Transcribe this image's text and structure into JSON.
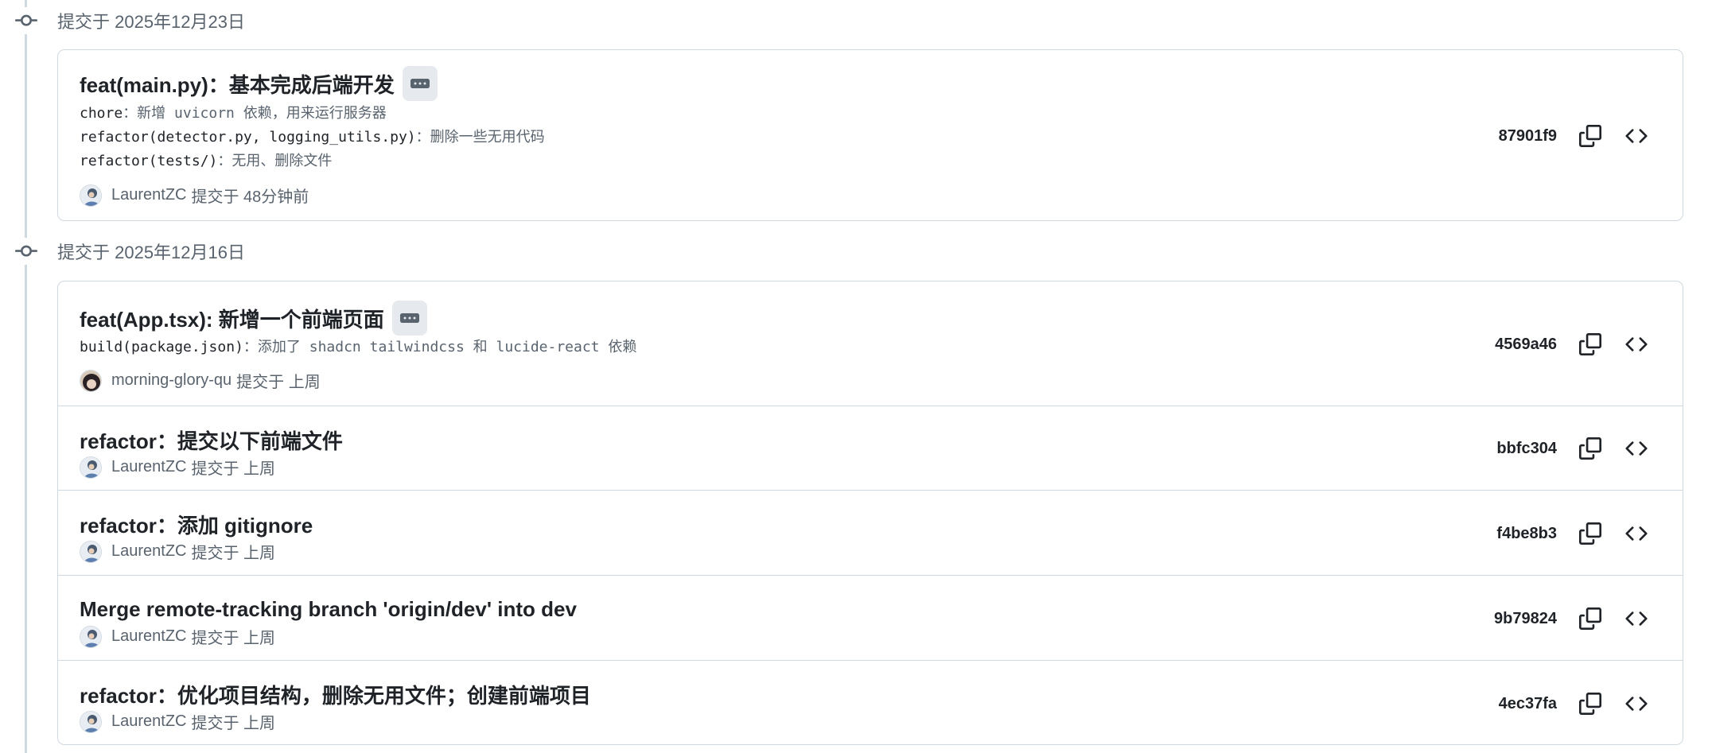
{
  "groups": [
    {
      "header": "提交于 2025年12月23日",
      "commits": [
        {
          "title": "feat(main.py)：基本完成后端开发",
          "has_body": true,
          "body": [
            {
              "prefix": "chore",
              "rest": "：新增 uvicorn 依赖，用来运行服务器"
            },
            {
              "prefix": "refactor(detector.py, logging_utils.py)",
              "rest": "：删除一些无用代码"
            },
            {
              "prefix": "refactor(tests/)",
              "rest": "：无用、删除文件"
            }
          ],
          "author": "LaurentZC",
          "verb": "提交于 48分钟前",
          "sha": "87901f9",
          "avatar": "laurent"
        }
      ]
    },
    {
      "header": "提交于 2025年12月16日",
      "commits": [
        {
          "title": "feat(App.tsx): 新增一个前端页面",
          "has_body": true,
          "body": [
            {
              "prefix": "build(package.json)",
              "rest": "：添加了 shadcn tailwindcss 和 lucide-react 依赖"
            }
          ],
          "author": "morning-glory-qu",
          "verb": "提交于 上周",
          "sha": "4569a46",
          "avatar": "morning"
        },
        {
          "title": "refactor：提交以下前端文件",
          "has_body": false,
          "body": [],
          "author": "LaurentZC",
          "verb": "提交于 上周",
          "sha": "bbfc304",
          "avatar": "laurent"
        },
        {
          "title": "refactor：添加 gitignore",
          "has_body": false,
          "body": [],
          "author": "LaurentZC",
          "verb": "提交于 上周",
          "sha": "f4be8b3",
          "avatar": "laurent"
        },
        {
          "title": "Merge remote-tracking branch 'origin/dev' into dev",
          "has_body": false,
          "body": [],
          "author": "LaurentZC",
          "verb": "提交于 上周",
          "sha": "9b79824",
          "avatar": "laurent"
        },
        {
          "title": "refactor：优化项目结构，删除无用文件；创建前端项目",
          "has_body": false,
          "body": [],
          "author": "LaurentZC",
          "verb": "提交于 上周",
          "sha": "4ec37fa",
          "avatar": "laurent"
        }
      ]
    }
  ],
  "icons": {
    "commit": "git-commit-icon",
    "ellipsis": "kebab-horizontal-icon",
    "copy": "copy-icon",
    "browse": "code-icon"
  },
  "colors": {
    "border": "#d1d9e0",
    "muted_text": "#59636e",
    "text": "#1f2328",
    "ellipsis_bg": "#e6eaef"
  }
}
